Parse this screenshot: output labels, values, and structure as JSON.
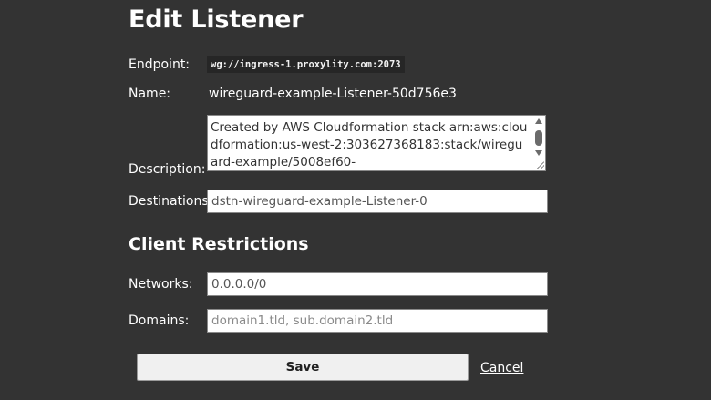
{
  "page": {
    "title": "Edit Listener"
  },
  "form": {
    "endpoint_label": "Endpoint:",
    "endpoint_value": "wg://ingress-1.proxylity.com:2073",
    "name_label": "Name:",
    "name_value": "wireguard-example-Listener-50d756e3",
    "description_label": "Description:",
    "description_value": "Created by AWS Cloudformation stack arn:aws:cloudformation:us-west-2:303627368183:stack/wireguard-example/5008ef60-",
    "destinations_label": "Destinations:",
    "destinations_value": "dstn-wireguard-example-Listener-0"
  },
  "client_restrictions": {
    "heading": "Client Restrictions",
    "networks_label": "Networks:",
    "networks_value": "0.0.0.0/0",
    "domains_label": "Domains:",
    "domains_placeholder": "domain1.tld, sub.domain2.tld"
  },
  "actions": {
    "save_label": "Save",
    "cancel_label": "Cancel"
  },
  "colors": {
    "background": "#333333",
    "text": "#ffffff",
    "input_background": "#ffffff"
  }
}
